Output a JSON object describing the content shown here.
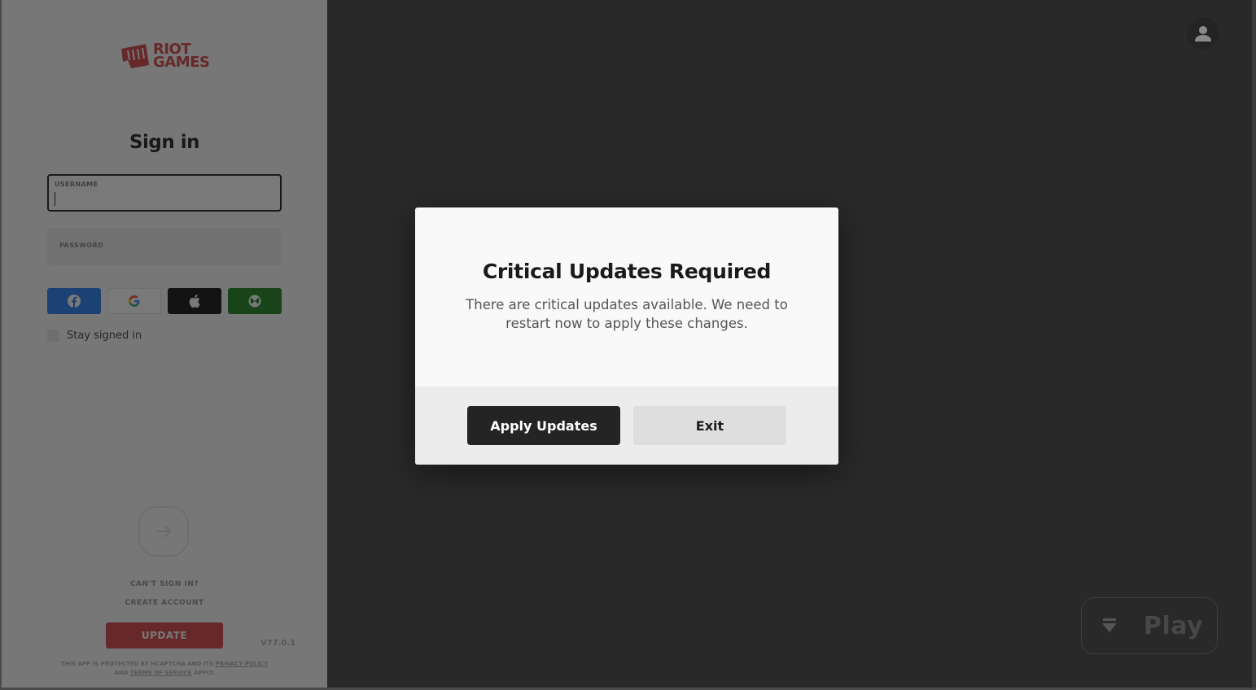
{
  "brand": {
    "logo_line1": "RIOT",
    "logo_line2": "GAMES",
    "accent_color": "#d13639"
  },
  "signin": {
    "title": "Sign in",
    "username_label": "USERNAME",
    "username_value": "",
    "password_label": "PASSWORD",
    "social_buttons": [
      {
        "name": "facebook",
        "icon": "facebook-icon",
        "color": "#1877f2"
      },
      {
        "name": "google",
        "icon": "google-icon",
        "color": "#ffffff"
      },
      {
        "name": "apple",
        "icon": "apple-icon",
        "color": "#000000"
      },
      {
        "name": "xbox",
        "icon": "xbox-icon",
        "color": "#107c10"
      }
    ],
    "stay_signed_in_label": "Stay signed in",
    "stay_signed_in_checked": false,
    "submit_icon": "arrow-right-icon",
    "cant_sign_in": "CAN'T SIGN IN?",
    "create_account": "CREATE ACCOUNT",
    "update_button": "UPDATE",
    "version": "V77.0.1",
    "legal_prefix": "THIS APP IS PROTECTED BY HCAPTCHA AND ITS",
    "legal_privacy": "PRIVACY POLICY",
    "legal_and": "AND",
    "legal_terms": "TERMS OF SERVICE",
    "legal_suffix": "APPLY."
  },
  "modal": {
    "title": "Critical Updates Required",
    "body": "There are critical updates available. We need to restart now to apply these changes.",
    "apply_button": "Apply Updates",
    "exit_button": "Exit"
  },
  "main": {
    "profile_icon": "user-icon",
    "play_icon": "download-arrow-icon",
    "play_label": "Play"
  }
}
